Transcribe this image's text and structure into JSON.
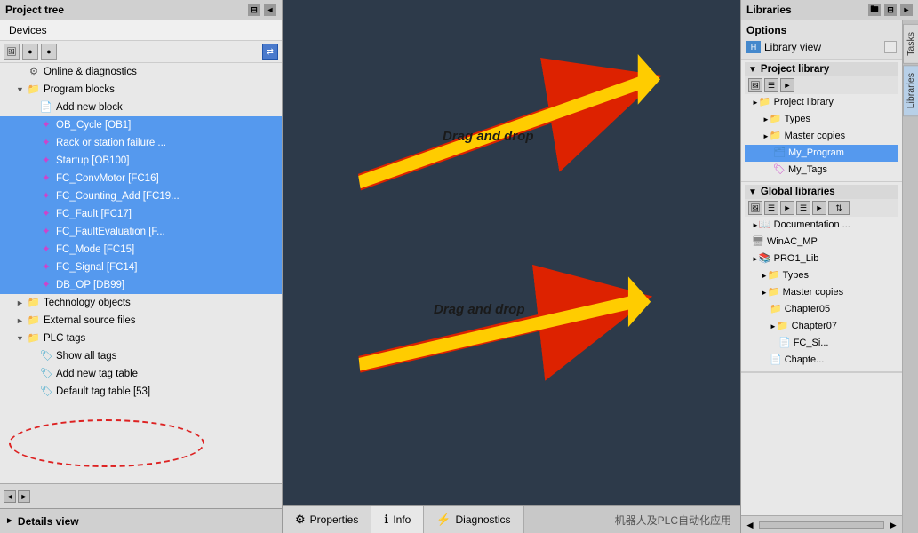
{
  "leftPanel": {
    "title": "Project tree",
    "devicesTab": "Devices",
    "treeItems": [
      {
        "id": "online-diag",
        "label": "Online & diagnostics",
        "indent": 1,
        "icon": "gear",
        "hasArrow": false,
        "type": "normal"
      },
      {
        "id": "program-blocks",
        "label": "Program blocks",
        "indent": 1,
        "icon": "folder",
        "hasArrow": true,
        "expanded": true,
        "type": "normal"
      },
      {
        "id": "add-new-block",
        "label": "Add new block",
        "indent": 2,
        "icon": "page",
        "hasArrow": false,
        "type": "normal"
      },
      {
        "id": "ob-cycle",
        "label": "OB_Cycle [OB1]",
        "indent": 2,
        "icon": "star",
        "hasArrow": false,
        "type": "highlight"
      },
      {
        "id": "rack-station",
        "label": "Rack or station failure ...",
        "indent": 2,
        "icon": "star",
        "hasArrow": false,
        "type": "highlight"
      },
      {
        "id": "startup",
        "label": "Startup [OB100]",
        "indent": 2,
        "icon": "star",
        "hasArrow": false,
        "type": "highlight"
      },
      {
        "id": "fc-convmotor",
        "label": "FC_ConvMotor [FC16]",
        "indent": 2,
        "icon": "star",
        "hasArrow": false,
        "type": "highlight"
      },
      {
        "id": "fc-counting",
        "label": "FC_Counting_Add [FC19...",
        "indent": 2,
        "icon": "star",
        "hasArrow": false,
        "type": "highlight"
      },
      {
        "id": "fc-fault",
        "label": "FC_Fault [FC17]",
        "indent": 2,
        "icon": "star",
        "hasArrow": false,
        "type": "highlight"
      },
      {
        "id": "fc-faultevaluation",
        "label": "FC_FaultEvaluation [F...",
        "indent": 2,
        "icon": "star",
        "hasArrow": false,
        "type": "highlight"
      },
      {
        "id": "fc-mode",
        "label": "FC_Mode [FC15]",
        "indent": 2,
        "icon": "star",
        "hasArrow": false,
        "type": "highlight"
      },
      {
        "id": "fc-signal",
        "label": "FC_Signal [FC14]",
        "indent": 2,
        "icon": "star",
        "hasArrow": false,
        "type": "highlight"
      },
      {
        "id": "db-op",
        "label": "DB_OP [DB99]",
        "indent": 2,
        "icon": "star",
        "hasArrow": false,
        "type": "highlight"
      },
      {
        "id": "tech-objects",
        "label": "Technology objects",
        "indent": 1,
        "icon": "folder",
        "hasArrow": true,
        "expanded": false,
        "type": "normal"
      },
      {
        "id": "ext-source",
        "label": "External source files",
        "indent": 1,
        "icon": "folder",
        "hasArrow": true,
        "expanded": false,
        "type": "normal"
      },
      {
        "id": "plc-tags",
        "label": "PLC tags",
        "indent": 1,
        "icon": "folder",
        "hasArrow": true,
        "expanded": true,
        "type": "normal"
      },
      {
        "id": "show-all-tags",
        "label": "Show all tags",
        "indent": 2,
        "icon": "tag",
        "hasArrow": false,
        "type": "normal"
      },
      {
        "id": "add-new-tag-table",
        "label": "Add new tag table",
        "indent": 2,
        "icon": "tag",
        "hasArrow": false,
        "type": "normal"
      },
      {
        "id": "default-tag-table",
        "label": "Default tag table [53]",
        "indent": 2,
        "icon": "tag",
        "hasArrow": false,
        "type": "normal"
      }
    ],
    "detailsView": "Details view",
    "scrollLeft": "◄",
    "scrollRight": "►"
  },
  "centerPanel": {
    "dragLabel1": "Drag and drop",
    "dragLabel2": "Drag and drop",
    "bottomTabs": [
      {
        "id": "properties",
        "label": "Properties",
        "icon": "⚙"
      },
      {
        "id": "info",
        "label": "Info",
        "icon": "ℹ"
      },
      {
        "id": "diagnostics",
        "label": "Diagnostics",
        "icon": "⚡"
      }
    ]
  },
  "rightPanel": {
    "title": "Libraries",
    "options": {
      "label": "Options",
      "libraryView": "Library view"
    },
    "projectLibrary": {
      "sectionLabel": "Project library",
      "items": [
        {
          "id": "proj-lib-root",
          "label": "Project library",
          "indent": 0,
          "hasArrow": true
        },
        {
          "id": "types",
          "label": "Types",
          "indent": 1,
          "hasArrow": true
        },
        {
          "id": "master-copies",
          "label": "Master copies",
          "indent": 1,
          "hasArrow": true
        },
        {
          "id": "my-program",
          "label": "My_Program",
          "indent": 2,
          "hasArrow": false,
          "selected": true
        },
        {
          "id": "my-tags",
          "label": "My_Tags",
          "indent": 2,
          "hasArrow": false
        }
      ]
    },
    "globalLibraries": {
      "sectionLabel": "Global libraries",
      "items": [
        {
          "id": "documentation",
          "label": "Documentation ...",
          "indent": 0,
          "hasArrow": true
        },
        {
          "id": "winac-mp",
          "label": "WinAC_MP",
          "indent": 0,
          "hasArrow": false
        },
        {
          "id": "pro1-lib",
          "label": "PRO1_Lib",
          "indent": 0,
          "hasArrow": true
        },
        {
          "id": "pro1-types",
          "label": "Types",
          "indent": 1,
          "hasArrow": true
        },
        {
          "id": "pro1-master",
          "label": "Master copies",
          "indent": 1,
          "hasArrow": true
        },
        {
          "id": "chapter05",
          "label": "Chapter05",
          "indent": 2,
          "hasArrow": false
        },
        {
          "id": "chapter07",
          "label": "Chapter07",
          "indent": 2,
          "hasArrow": true
        },
        {
          "id": "fc-si",
          "label": "FC_Si...",
          "indent": 3,
          "hasArrow": false
        },
        {
          "id": "chapter-more",
          "label": "Chapte...",
          "indent": 2,
          "hasArrow": false
        }
      ]
    },
    "sideTabs": [
      "Tasks",
      "Libraries"
    ]
  },
  "watermark": "机器人及PLC自动化应用"
}
